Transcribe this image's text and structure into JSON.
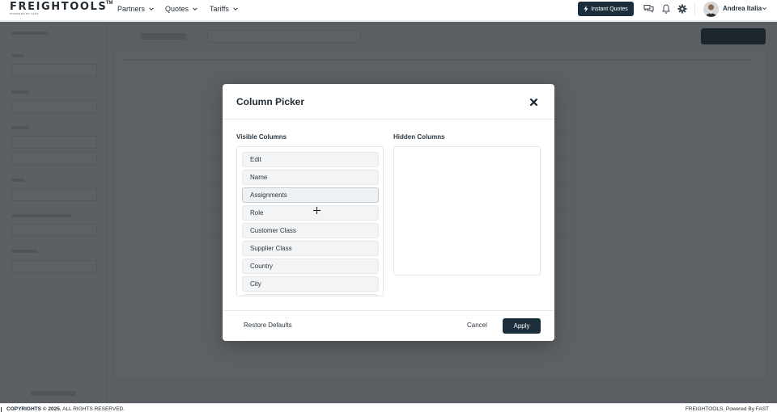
{
  "app": {
    "logo_text": "FREIGHTOOLS",
    "logo_tm": "TM",
    "logo_sub": "POWERED BY FAST"
  },
  "nav": {
    "items": [
      {
        "label": "Partners"
      },
      {
        "label": "Quotes"
      },
      {
        "label": "Tariffs"
      }
    ],
    "instant_quotes_label": "Instant Quotes",
    "user_name": "Andrea Italia"
  },
  "footer": {
    "copyright_bold": "COPYRIGHTS © 2025.",
    "copyright_rest": " ALL RIGHTS RESERVED.",
    "powered": "FREIGHTOOLS. Powered By FAST"
  },
  "modal": {
    "title": "Column Picker",
    "visible_label": "Visible Columns",
    "hidden_label": "Hidden Columns",
    "visible_columns": [
      "Edit",
      "Name",
      "Assignments",
      "Role",
      "Customer Class",
      "Supplier Class",
      "Country",
      "City"
    ],
    "hidden_columns": [],
    "restore_label": "Restore Defaults",
    "cancel_label": "Cancel",
    "apply_label": "Apply"
  },
  "colors": {
    "brand_dark": "#1b2e3c",
    "overlay": "#202428"
  }
}
